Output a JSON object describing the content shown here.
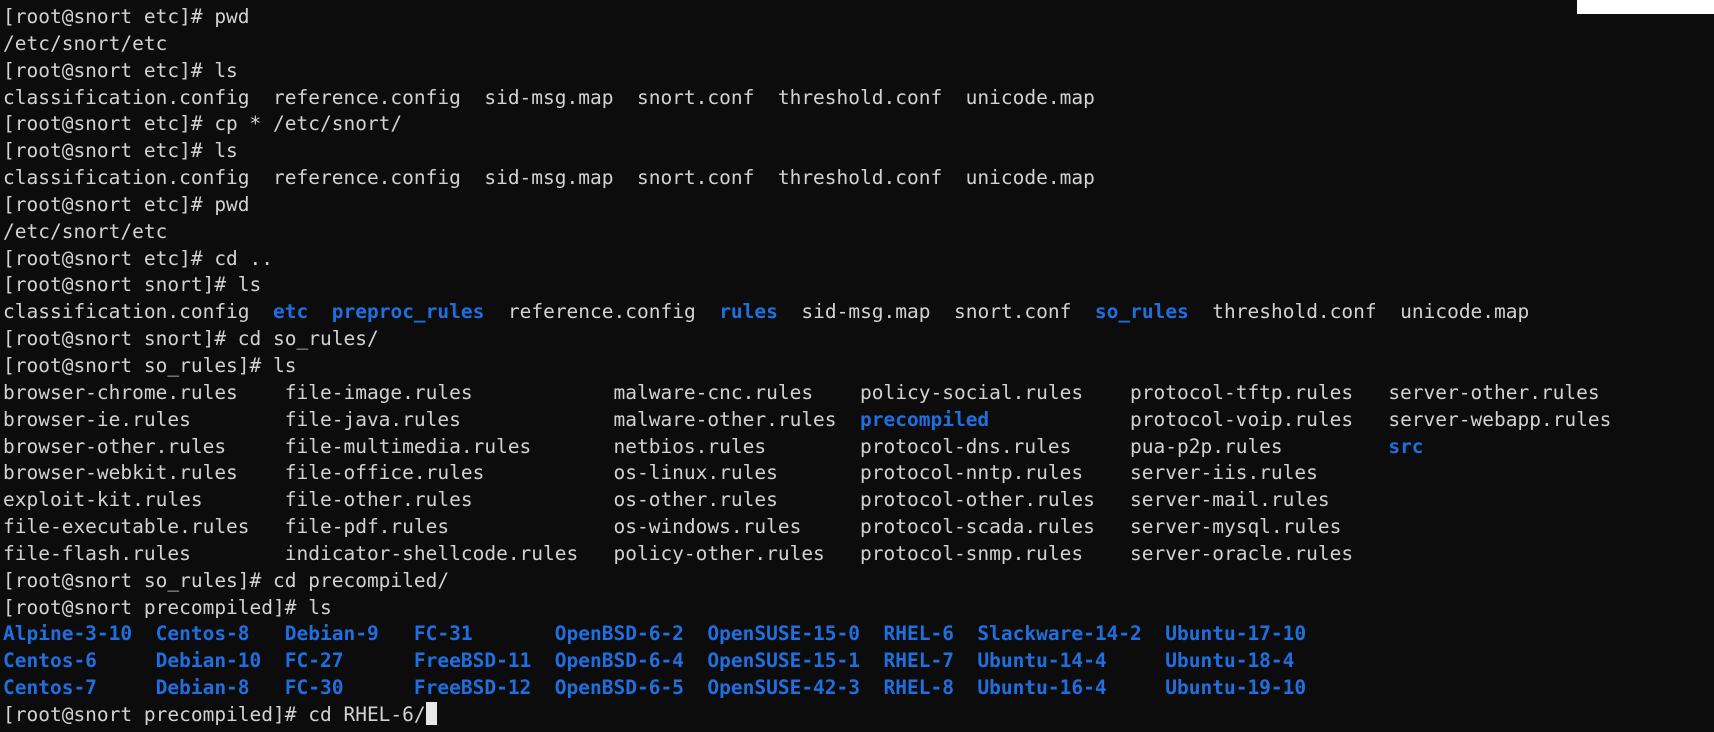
{
  "terminal": {
    "prompt_user": "root",
    "prompt_host": "snort",
    "cursor_line_index": 26
  },
  "colors": {
    "background": "#0c0c0c",
    "text": "#d2d2d2",
    "directory": "#1f6fe0",
    "cursor": "#e8e8e8"
  },
  "lines": [
    [
      {
        "t": "[root@snort etc]# pwd"
      }
    ],
    [
      {
        "t": "/etc/snort/etc"
      }
    ],
    [
      {
        "t": "[root@snort etc]# ls"
      }
    ],
    [
      {
        "t": "classification.config  reference.config  sid-msg.map  snort.conf  threshold.conf  unicode.map"
      }
    ],
    [
      {
        "t": "[root@snort etc]# cp * /etc/snort/"
      }
    ],
    [
      {
        "t": "[root@snort etc]# ls"
      }
    ],
    [
      {
        "t": "classification.config  reference.config  sid-msg.map  snort.conf  threshold.conf  unicode.map"
      }
    ],
    [
      {
        "t": "[root@snort etc]# pwd"
      }
    ],
    [
      {
        "t": "/etc/snort/etc"
      }
    ],
    [
      {
        "t": "[root@snort etc]# cd .."
      }
    ],
    [
      {
        "t": "[root@snort snort]# ls"
      }
    ],
    [
      {
        "t": "classification.config  "
      },
      {
        "t": "etc",
        "c": "blue"
      },
      {
        "t": "  "
      },
      {
        "t": "preproc_rules",
        "c": "blue"
      },
      {
        "t": "  reference.config  "
      },
      {
        "t": "rules",
        "c": "blue"
      },
      {
        "t": "  sid-msg.map  snort.conf  "
      },
      {
        "t": "so_rules",
        "c": "blue"
      },
      {
        "t": "  threshold.conf  unicode.map"
      }
    ],
    [
      {
        "t": "[root@snort snort]# cd so_rules/"
      }
    ],
    [
      {
        "t": "[root@snort so_rules]# ls"
      }
    ],
    [
      {
        "t": "browser-chrome.rules    file-image.rules            malware-cnc.rules    policy-social.rules    protocol-tftp.rules   server-other.rules"
      }
    ],
    [
      {
        "t": "browser-ie.rules        file-java.rules             malware-other.rules  "
      },
      {
        "t": "precompiled",
        "c": "blue"
      },
      {
        "t": "            protocol-voip.rules   server-webapp.rules"
      }
    ],
    [
      {
        "t": "browser-other.rules     file-multimedia.rules       netbios.rules        protocol-dns.rules     pua-p2p.rules         "
      },
      {
        "t": "src",
        "c": "blue"
      }
    ],
    [
      {
        "t": "browser-webkit.rules    file-office.rules           os-linux.rules       protocol-nntp.rules    server-iis.rules"
      }
    ],
    [
      {
        "t": "exploit-kit.rules       file-other.rules            os-other.rules       protocol-other.rules   server-mail.rules"
      }
    ],
    [
      {
        "t": "file-executable.rules   file-pdf.rules              os-windows.rules     protocol-scada.rules   server-mysql.rules"
      }
    ],
    [
      {
        "t": "file-flash.rules        indicator-shellcode.rules   policy-other.rules   protocol-snmp.rules    server-oracle.rules"
      }
    ],
    [
      {
        "t": "[root@snort so_rules]# cd precompiled/"
      }
    ],
    [
      {
        "t": "[root@snort precompiled]# ls"
      }
    ],
    [
      {
        "t": "Alpine-3-10  Centos-8   Debian-9   FC-31       OpenBSD-6-2  OpenSUSE-15-0  RHEL-6  Slackware-14-2  Ubuntu-17-10",
        "c": "blue"
      }
    ],
    [
      {
        "t": "Centos-6     Debian-10  FC-27      FreeBSD-11  OpenBSD-6-4  OpenSUSE-15-1  RHEL-7  Ubuntu-14-4     Ubuntu-18-4",
        "c": "blue"
      }
    ],
    [
      {
        "t": "Centos-7     Debian-8   FC-30      FreeBSD-12  OpenBSD-6-5  OpenSUSE-42-3  RHEL-8  Ubuntu-16-4     Ubuntu-19-10",
        "c": "blue"
      }
    ],
    [
      {
        "t": "[root@snort precompiled]# cd RHEL-6/"
      }
    ]
  ]
}
